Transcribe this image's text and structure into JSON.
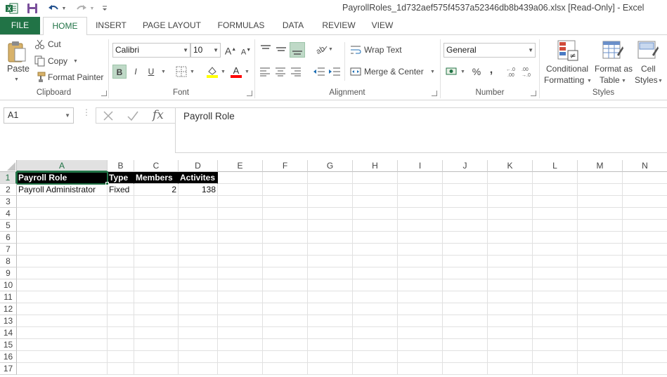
{
  "app": {
    "title": "PayrollRoles_1d732aef575f4537a52346db8b439a06.xlsx  [Read-Only] - Excel",
    "brand_color": "#217346"
  },
  "quick_access": {
    "icons": [
      "excel-logo-icon",
      "save-icon",
      "undo-icon",
      "redo-icon",
      "customize-qat-icon"
    ]
  },
  "tabs": [
    {
      "label": "FILE"
    },
    {
      "label": "HOME"
    },
    {
      "label": "INSERT"
    },
    {
      "label": "PAGE LAYOUT"
    },
    {
      "label": "FORMULAS"
    },
    {
      "label": "DATA"
    },
    {
      "label": "REVIEW"
    },
    {
      "label": "VIEW"
    }
  ],
  "ribbon": {
    "clipboard": {
      "paste": "Paste",
      "cut": "Cut",
      "copy": "Copy",
      "format_painter": "Format Painter",
      "group": "Clipboard"
    },
    "font": {
      "family": "Calibri",
      "size": "10",
      "bold": "B",
      "italic": "I",
      "underline": "U",
      "group": "Font"
    },
    "alignment": {
      "wrap_text": "Wrap Text",
      "merge_center": "Merge & Center",
      "group": "Alignment"
    },
    "number": {
      "format": "General",
      "percent": "%",
      "comma": ",",
      "group": "Number"
    },
    "styles": {
      "conditional_1": "Conditional",
      "conditional_2": "Formatting",
      "format_as_1": "Format as",
      "format_as_2": "Table",
      "cell_styles_1": "Cell",
      "cell_styles_2": "Styles",
      "group": "Styles"
    }
  },
  "formula_bar": {
    "name_box": "A1",
    "fx": "fx",
    "value": "Payroll Role"
  },
  "sheet": {
    "columns": [
      "A",
      "B",
      "C",
      "D",
      "E",
      "F",
      "G",
      "H",
      "I",
      "J",
      "K",
      "L",
      "M",
      "N"
    ],
    "rows": [
      "1",
      "2",
      "3",
      "4",
      "5",
      "6",
      "7",
      "8",
      "9",
      "10",
      "11",
      "12",
      "13",
      "14",
      "15",
      "16",
      "17"
    ],
    "header_row": [
      "Payroll Role",
      "Type",
      "Members",
      "Activites"
    ],
    "data_rows": [
      [
        "Payroll Administrator",
        "Fixed",
        "2",
        "138"
      ]
    ],
    "active_cell": "A1"
  }
}
